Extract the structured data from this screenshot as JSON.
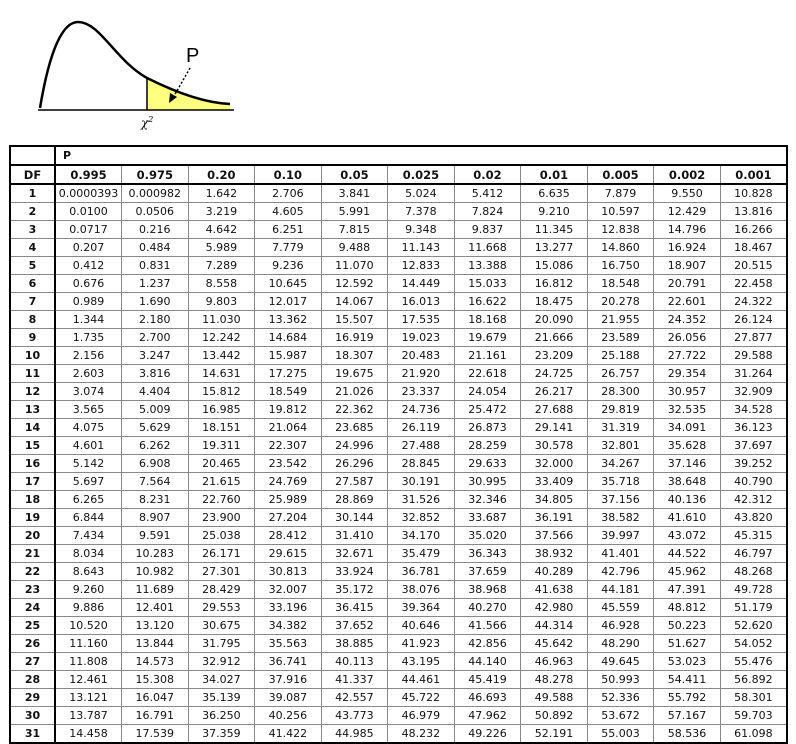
{
  "figure": {
    "p_label": "P",
    "x_label": "χ",
    "x_label_sup": "2",
    "fill_color": "#ffff80"
  },
  "table": {
    "group_label": "P",
    "df_header": "DF",
    "columns": [
      "0.995",
      "0.975",
      "0.20",
      "0.10",
      "0.05",
      "0.025",
      "0.02",
      "0.01",
      "0.005",
      "0.002",
      "0.001"
    ],
    "rows": [
      [
        "1",
        "0.0000393",
        "0.000982",
        "1.642",
        "2.706",
        "3.841",
        "5.024",
        "5.412",
        "6.635",
        "7.879",
        "9.550",
        "10.828"
      ],
      [
        "2",
        "0.0100",
        "0.0506",
        "3.219",
        "4.605",
        "5.991",
        "7.378",
        "7.824",
        "9.210",
        "10.597",
        "12.429",
        "13.816"
      ],
      [
        "3",
        "0.0717",
        "0.216",
        "4.642",
        "6.251",
        "7.815",
        "9.348",
        "9.837",
        "11.345",
        "12.838",
        "14.796",
        "16.266"
      ],
      [
        "4",
        "0.207",
        "0.484",
        "5.989",
        "7.779",
        "9.488",
        "11.143",
        "11.668",
        "13.277",
        "14.860",
        "16.924",
        "18.467"
      ],
      [
        "5",
        "0.412",
        "0.831",
        "7.289",
        "9.236",
        "11.070",
        "12.833",
        "13.388",
        "15.086",
        "16.750",
        "18.907",
        "20.515"
      ],
      [
        "6",
        "0.676",
        "1.237",
        "8.558",
        "10.645",
        "12.592",
        "14.449",
        "15.033",
        "16.812",
        "18.548",
        "20.791",
        "22.458"
      ],
      [
        "7",
        "0.989",
        "1.690",
        "9.803",
        "12.017",
        "14.067",
        "16.013",
        "16.622",
        "18.475",
        "20.278",
        "22.601",
        "24.322"
      ],
      [
        "8",
        "1.344",
        "2.180",
        "11.030",
        "13.362",
        "15.507",
        "17.535",
        "18.168",
        "20.090",
        "21.955",
        "24.352",
        "26.124"
      ],
      [
        "9",
        "1.735",
        "2.700",
        "12.242",
        "14.684",
        "16.919",
        "19.023",
        "19.679",
        "21.666",
        "23.589",
        "26.056",
        "27.877"
      ],
      [
        "10",
        "2.156",
        "3.247",
        "13.442",
        "15.987",
        "18.307",
        "20.483",
        "21.161",
        "23.209",
        "25.188",
        "27.722",
        "29.588"
      ],
      [
        "11",
        "2.603",
        "3.816",
        "14.631",
        "17.275",
        "19.675",
        "21.920",
        "22.618",
        "24.725",
        "26.757",
        "29.354",
        "31.264"
      ],
      [
        "12",
        "3.074",
        "4.404",
        "15.812",
        "18.549",
        "21.026",
        "23.337",
        "24.054",
        "26.217",
        "28.300",
        "30.957",
        "32.909"
      ],
      [
        "13",
        "3.565",
        "5.009",
        "16.985",
        "19.812",
        "22.362",
        "24.736",
        "25.472",
        "27.688",
        "29.819",
        "32.535",
        "34.528"
      ],
      [
        "14",
        "4.075",
        "5.629",
        "18.151",
        "21.064",
        "23.685",
        "26.119",
        "26.873",
        "29.141",
        "31.319",
        "34.091",
        "36.123"
      ],
      [
        "15",
        "4.601",
        "6.262",
        "19.311",
        "22.307",
        "24.996",
        "27.488",
        "28.259",
        "30.578",
        "32.801",
        "35.628",
        "37.697"
      ],
      [
        "16",
        "5.142",
        "6.908",
        "20.465",
        "23.542",
        "26.296",
        "28.845",
        "29.633",
        "32.000",
        "34.267",
        "37.146",
        "39.252"
      ],
      [
        "17",
        "5.697",
        "7.564",
        "21.615",
        "24.769",
        "27.587",
        "30.191",
        "30.995",
        "33.409",
        "35.718",
        "38.648",
        "40.790"
      ],
      [
        "18",
        "6.265",
        "8.231",
        "22.760",
        "25.989",
        "28.869",
        "31.526",
        "32.346",
        "34.805",
        "37.156",
        "40.136",
        "42.312"
      ],
      [
        "19",
        "6.844",
        "8.907",
        "23.900",
        "27.204",
        "30.144",
        "32.852",
        "33.687",
        "36.191",
        "38.582",
        "41.610",
        "43.820"
      ],
      [
        "20",
        "7.434",
        "9.591",
        "25.038",
        "28.412",
        "31.410",
        "34.170",
        "35.020",
        "37.566",
        "39.997",
        "43.072",
        "45.315"
      ],
      [
        "21",
        "8.034",
        "10.283",
        "26.171",
        "29.615",
        "32.671",
        "35.479",
        "36.343",
        "38.932",
        "41.401",
        "44.522",
        "46.797"
      ],
      [
        "22",
        "8.643",
        "10.982",
        "27.301",
        "30.813",
        "33.924",
        "36.781",
        "37.659",
        "40.289",
        "42.796",
        "45.962",
        "48.268"
      ],
      [
        "23",
        "9.260",
        "11.689",
        "28.429",
        "32.007",
        "35.172",
        "38.076",
        "38.968",
        "41.638",
        "44.181",
        "47.391",
        "49.728"
      ],
      [
        "24",
        "9.886",
        "12.401",
        "29.553",
        "33.196",
        "36.415",
        "39.364",
        "40.270",
        "42.980",
        "45.559",
        "48.812",
        "51.179"
      ],
      [
        "25",
        "10.520",
        "13.120",
        "30.675",
        "34.382",
        "37.652",
        "40.646",
        "41.566",
        "44.314",
        "46.928",
        "50.223",
        "52.620"
      ],
      [
        "26",
        "11.160",
        "13.844",
        "31.795",
        "35.563",
        "38.885",
        "41.923",
        "42.856",
        "45.642",
        "48.290",
        "51.627",
        "54.052"
      ],
      [
        "27",
        "11.808",
        "14.573",
        "32.912",
        "36.741",
        "40.113",
        "43.195",
        "44.140",
        "46.963",
        "49.645",
        "53.023",
        "55.476"
      ],
      [
        "28",
        "12.461",
        "15.308",
        "34.027",
        "37.916",
        "41.337",
        "44.461",
        "45.419",
        "48.278",
        "50.993",
        "54.411",
        "56.892"
      ],
      [
        "29",
        "13.121",
        "16.047",
        "35.139",
        "39.087",
        "42.557",
        "45.722",
        "46.693",
        "49.588",
        "52.336",
        "55.792",
        "58.301"
      ],
      [
        "30",
        "13.787",
        "16.791",
        "36.250",
        "40.256",
        "43.773",
        "46.979",
        "47.962",
        "50.892",
        "53.672",
        "57.167",
        "59.703"
      ],
      [
        "31",
        "14.458",
        "17.539",
        "37.359",
        "41.422",
        "44.985",
        "48.232",
        "49.226",
        "52.191",
        "55.003",
        "58.536",
        "61.098"
      ]
    ]
  }
}
